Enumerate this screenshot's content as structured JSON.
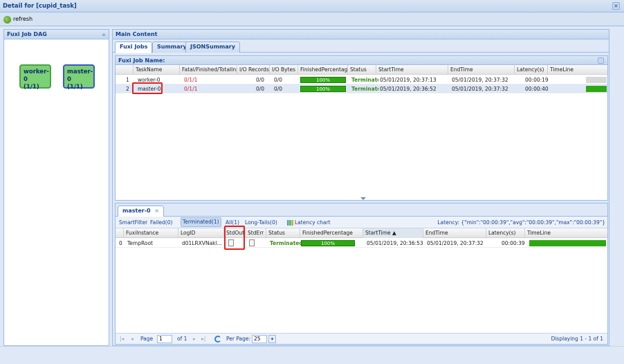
{
  "window": {
    "title": "Detail for [cupid_task]",
    "close_glyph": "×"
  },
  "toolbar": {
    "refresh_label": "refresh",
    "refresh_icon": "refresh-icon"
  },
  "dag": {
    "title": "Fuxi Job DAG",
    "collapse_glyph": "«",
    "nodes": [
      {
        "name": "worker-0",
        "count": "(1/1)"
      },
      {
        "name": "master-0",
        "count": "(1/1)"
      }
    ]
  },
  "main": {
    "title": "Main Content",
    "tabs": [
      "Fuxi Jobs",
      "Summary",
      "JSONSummary"
    ]
  },
  "jobs_grid": {
    "title": "Fuxi Job Name:",
    "columns": [
      "TaskName",
      "Fatal/Finished/TotalInstCount",
      "I/O Records",
      "I/O Bytes",
      "FinishedPercentage",
      "Status",
      "StartTime",
      "EndTime",
      "Latency(s)",
      "TimeLine"
    ],
    "rows": [
      {
        "num": "1",
        "task": "worker-0",
        "count": "0/1/1",
        "records": "0/0",
        "bytes": "0/0",
        "pct": "100%",
        "status": "Terminated",
        "start": "05/01/2019, 20:37:13",
        "end": "05/01/2019, 20:37:32",
        "latency": "00:00:19"
      },
      {
        "num": "2",
        "task": "master-0",
        "count": "0/1/1",
        "records": "0/0",
        "bytes": "0/0",
        "pct": "100%",
        "status": "Terminated",
        "start": "05/01/2019, 20:36:52",
        "end": "05/01/2019, 20:37:32",
        "latency": "00:00:40"
      }
    ]
  },
  "detail": {
    "tab_label": "master-0",
    "filters": {
      "smart": "SmartFilter",
      "failed": "Failed(0)",
      "terminated": "Terminated(1)",
      "all": "All(1)",
      "longtails": "Long-Tails(0)",
      "latency_chart": "Latency chart"
    },
    "latency_summary": "Latency: {\"min\":\"00:00:39\",\"avg\":\"00:00:39\",\"max\":\"00:00:39\"}",
    "columns": [
      "FuxiInstance",
      "LogID",
      "StdOut",
      "StdErr",
      "Status",
      "FinishedPercentage",
      "StartTime ▲",
      "EndTime",
      "Latency(s)",
      "TimeLine"
    ],
    "rows": [
      {
        "num": "0",
        "instance": "TempRoot",
        "logid": "d01LRXVNakl...",
        "status": "Terminated",
        "pct": "100%",
        "start": "05/01/2019, 20:36:53",
        "end": "05/01/2019, 20:37:32",
        "latency": "00:00:39"
      }
    ],
    "pager": {
      "first": "|◂",
      "prev": "◂",
      "page_label": "Page",
      "page_value": "1",
      "of_label": "of 1",
      "next": "▸",
      "last": "▸|",
      "per_page_label": "Per Page:",
      "per_page_value": "25",
      "displaying": "Displaying 1 - 1 of 1"
    }
  }
}
